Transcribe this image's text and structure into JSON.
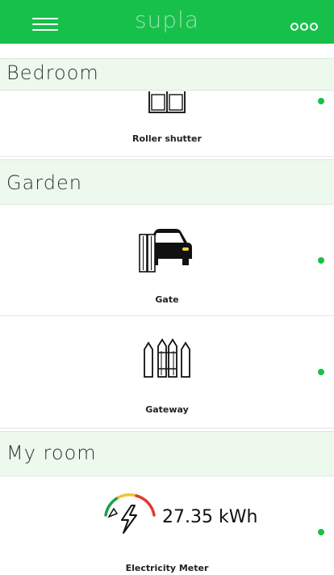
{
  "app_title": "supla",
  "accent_color": "#17c04b",
  "status_color": "#17c04b",
  "header": {
    "menu_icon": "hamburger-icon",
    "more_icon": "more-options-icon"
  },
  "sections": [
    {
      "name": "Bedroom",
      "channels": [
        {
          "caption": "Roller shutter",
          "icon": "roller-shutter-icon",
          "online": true
        }
      ]
    },
    {
      "name": "Garden",
      "channels": [
        {
          "caption": "Gate",
          "icon": "gate-icon",
          "online": true
        },
        {
          "caption": "Gateway",
          "icon": "gateway-icon",
          "online": true
        }
      ]
    },
    {
      "name": "My room",
      "channels": [
        {
          "caption": "Electricity Meter",
          "icon": "electricity-meter-icon",
          "value": "27.35 kWh",
          "online": true
        }
      ]
    }
  ]
}
